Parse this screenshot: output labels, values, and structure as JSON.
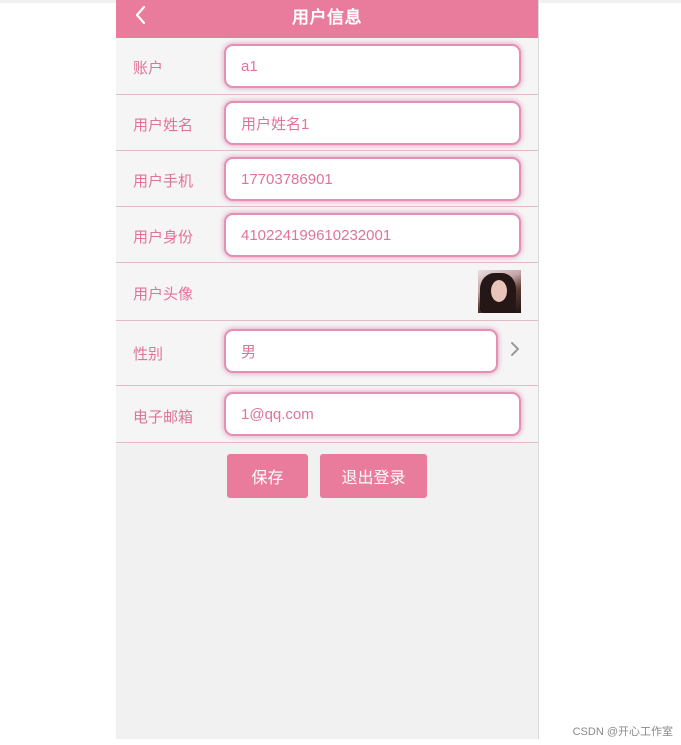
{
  "header": {
    "title": "用户信息"
  },
  "form": {
    "account": {
      "label": "账户",
      "value": "a1"
    },
    "name": {
      "label": "用户姓名",
      "value": "用户姓名1"
    },
    "phone": {
      "label": "用户手机",
      "value": "17703786901"
    },
    "id_card": {
      "label": "用户身份",
      "value": "410224199610232001"
    },
    "avatar": {
      "label": "用户头像"
    },
    "gender": {
      "label": "性别",
      "value": "男"
    },
    "email": {
      "label": "电子邮箱",
      "value": "1@qq.com"
    }
  },
  "buttons": {
    "save": "保存",
    "logout": "退出登录"
  },
  "watermark": "CSDN @开心工作室",
  "colors": {
    "accent": "#e97b9c",
    "text": "#e07399",
    "field_border": "#e58fb2",
    "background": "#f1f1f1"
  },
  "icons": {
    "back": "chevron-left-icon",
    "gender_select": "chevron-right-icon"
  }
}
